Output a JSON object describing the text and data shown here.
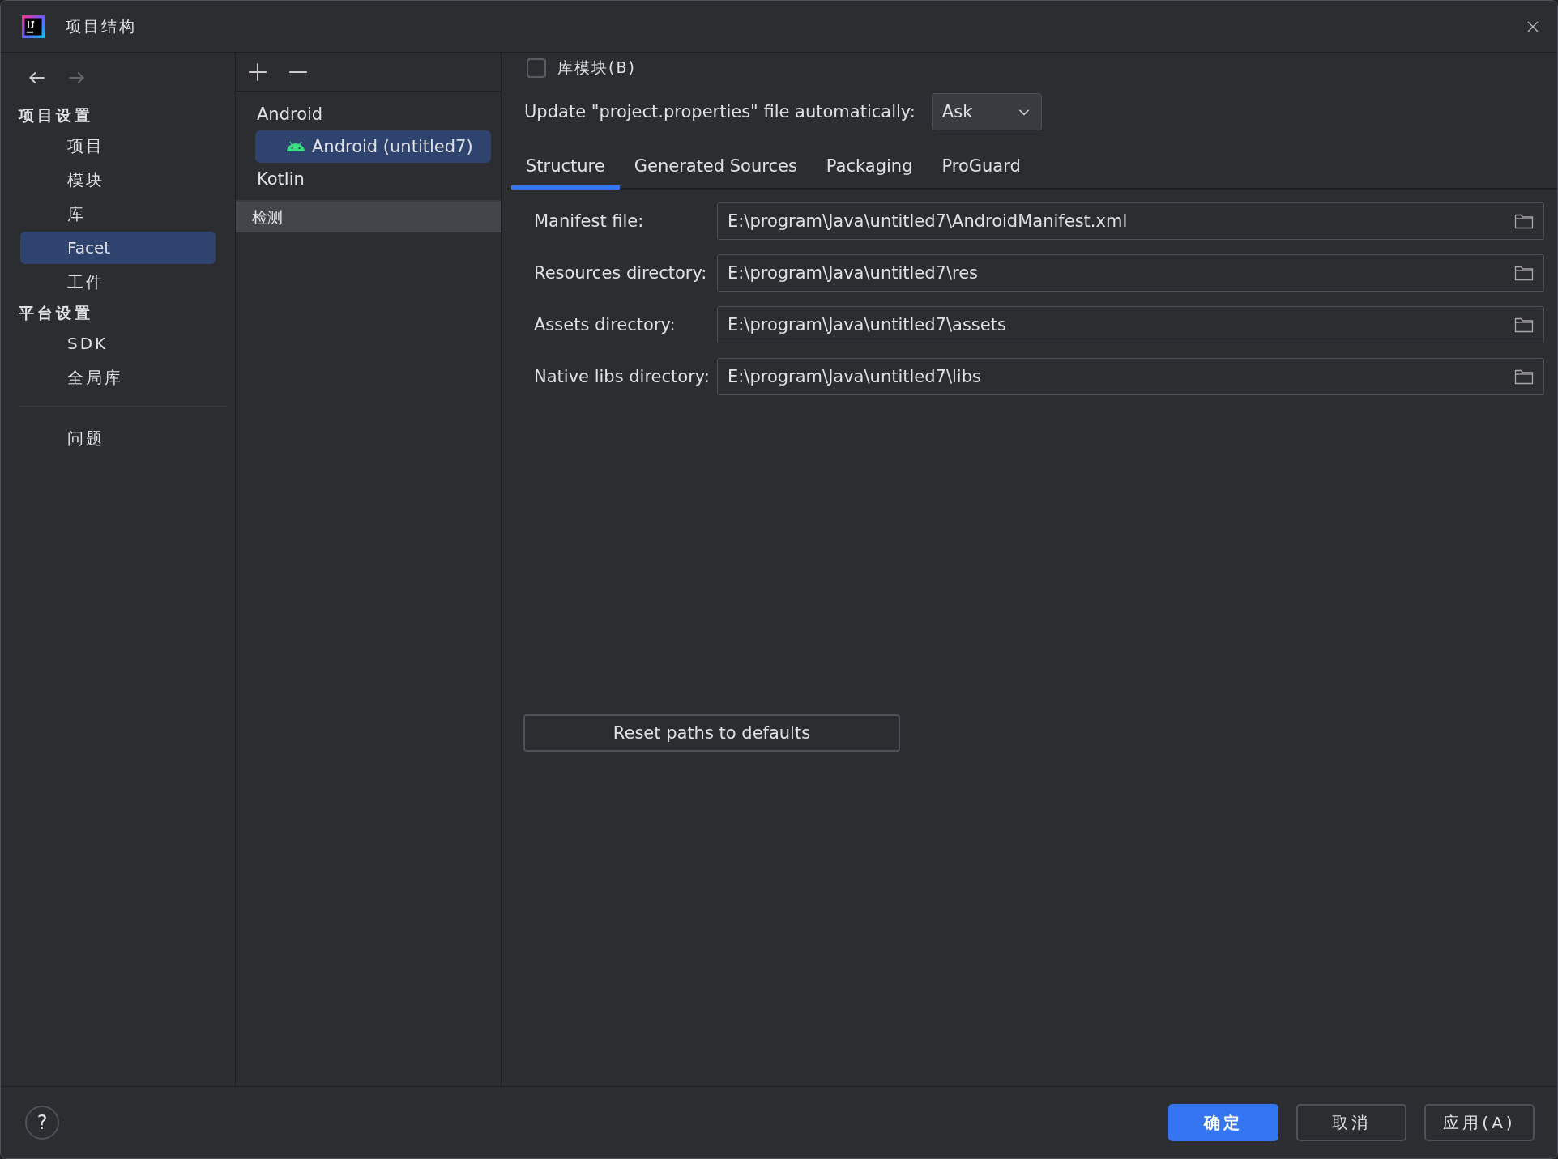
{
  "window": {
    "title": "项目结构"
  },
  "sidebar": {
    "sections": [
      {
        "title": "项目设置",
        "items": [
          {
            "label": "项目",
            "selected": false
          },
          {
            "label": "模块",
            "selected": false
          },
          {
            "label": "库",
            "selected": false
          },
          {
            "label": "Facet",
            "selected": true
          },
          {
            "label": "工件",
            "selected": false
          }
        ]
      },
      {
        "title": "平台设置",
        "items": [
          {
            "label": "SDK",
            "selected": false
          },
          {
            "label": "全局库",
            "selected": false
          }
        ]
      }
    ],
    "bottom_items": [
      {
        "label": "问题",
        "selected": false
      }
    ]
  },
  "facet_tree": {
    "items": [
      {
        "label": "Android",
        "selected": false,
        "children": [
          {
            "label": "Android (untitled7)",
            "selected": true,
            "kind": "android"
          }
        ]
      },
      {
        "label": "Kotlin",
        "selected": false
      }
    ],
    "detection": {
      "label": "检测"
    }
  },
  "library_module": {
    "label": "库模块(B)",
    "checked": false
  },
  "update_properties": {
    "label": "Update \"project.properties\" file automatically:",
    "value": "Ask"
  },
  "tabs": [
    {
      "label": "Structure",
      "selected": true
    },
    {
      "label": "Generated Sources",
      "selected": false
    },
    {
      "label": "Packaging",
      "selected": false
    },
    {
      "label": "ProGuard",
      "selected": false
    }
  ],
  "fields": [
    {
      "label": "Manifest file:",
      "value": "E:\\program\\Java\\untitled7\\AndroidManifest.xml"
    },
    {
      "label": "Resources directory:",
      "value": "E:\\program\\Java\\untitled7\\res"
    },
    {
      "label": "Assets directory:",
      "value": "E:\\program\\Java\\untitled7\\assets"
    },
    {
      "label": "Native libs directory:",
      "value": "E:\\program\\Java\\untitled7\\libs"
    }
  ],
  "reset_button": "Reset paths to defaults",
  "footer": {
    "help": "?",
    "buttons": [
      {
        "label": "确定",
        "kind": "primary"
      },
      {
        "label": "取消",
        "kind": "secondary"
      },
      {
        "label": "应用(A)",
        "kind": "secondary"
      }
    ]
  }
}
